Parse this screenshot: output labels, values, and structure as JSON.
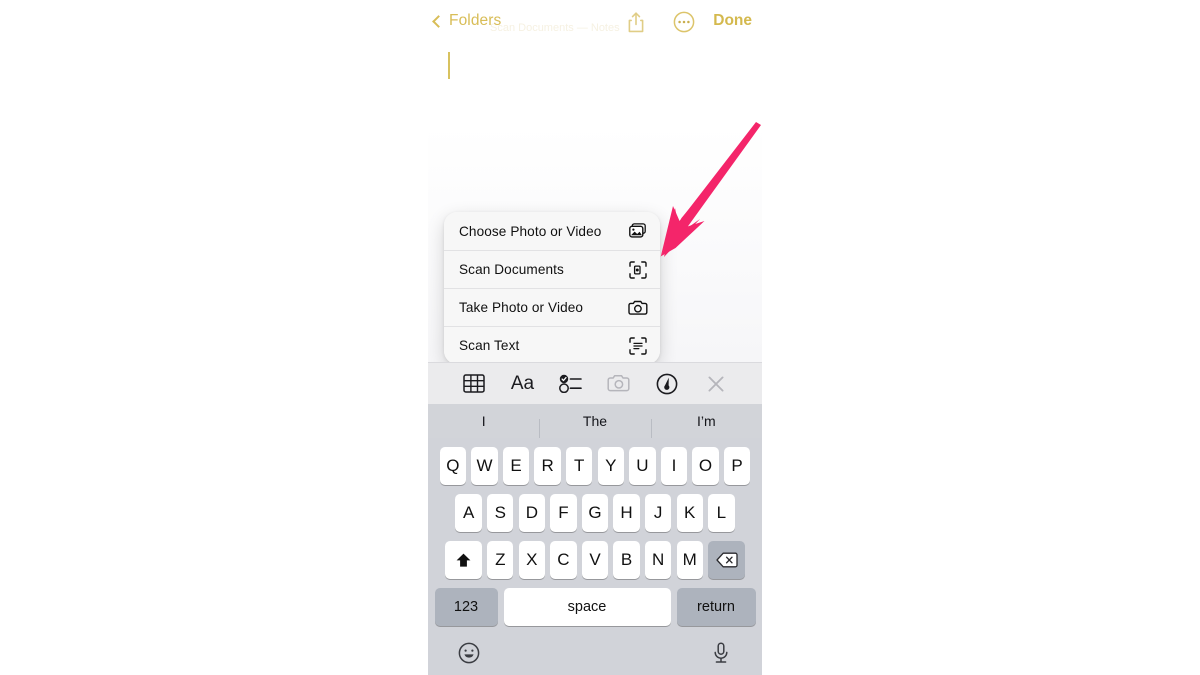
{
  "app": {
    "name": "Apple Notes",
    "platform": "iOS"
  },
  "navbar": {
    "back_label": "Folders",
    "back_icon": "chevron-left-icon",
    "share_icon": "share-up-arrow-icon",
    "more_icon": "ellipsis-circle-icon",
    "done_label": "Done",
    "tint_color": "#d4b94e",
    "watermark_text": "Scan Documents  —  Notes"
  },
  "note": {
    "body_text": "",
    "caret_color": "#d8c25f"
  },
  "context_menu": {
    "items": [
      {
        "label": "Choose Photo or Video",
        "icon": "photo-stack-icon"
      },
      {
        "label": "Scan Documents",
        "icon": "document-scan-icon"
      },
      {
        "label": "Take Photo or Video",
        "icon": "camera-icon"
      },
      {
        "label": "Scan Text",
        "icon": "text-scan-icon"
      }
    ],
    "background_color": "#f7f7f7"
  },
  "annotation": {
    "arrow_color": "#f4256a",
    "points_to": "Scan Documents"
  },
  "format_toolbar": {
    "items": [
      {
        "name": "table-icon",
        "label": "Table",
        "enabled": true
      },
      {
        "name": "text-format-icon",
        "label": "Aa",
        "enabled": true
      },
      {
        "name": "checklist-icon",
        "label": "Checklist",
        "enabled": true
      },
      {
        "name": "camera-icon",
        "label": "Camera",
        "enabled": false
      },
      {
        "name": "markup-pen-icon",
        "label": "Markup",
        "enabled": true
      },
      {
        "name": "close-icon",
        "label": "Close",
        "enabled": true
      }
    ]
  },
  "predictive_bar": {
    "suggestions": [
      "I",
      "The",
      "I’m"
    ]
  },
  "keyboard": {
    "row1": [
      "Q",
      "W",
      "E",
      "R",
      "T",
      "Y",
      "U",
      "I",
      "O",
      "P"
    ],
    "row2": [
      "A",
      "S",
      "D",
      "F",
      "G",
      "H",
      "J",
      "K",
      "L"
    ],
    "row3": [
      "Z",
      "X",
      "C",
      "V",
      "B",
      "N",
      "M"
    ],
    "shift_icon": "shift-up-arrow-icon",
    "delete_icon": "backspace-delete-icon",
    "numbers_label": "123",
    "space_label": "space",
    "return_label": "return",
    "emoji_icon": "emoji-smiley-icon",
    "dictation_icon": "microphone-icon",
    "background_color": "#d1d3d9",
    "modifier_key_color": "#adb3bd",
    "letter_key_color": "#ffffff"
  }
}
